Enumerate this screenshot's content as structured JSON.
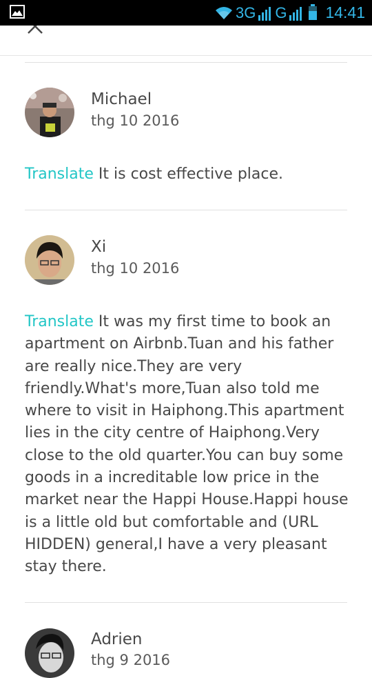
{
  "status_bar": {
    "network1": "3G",
    "network2": "G",
    "time": "14:41"
  },
  "reviews": [
    {
      "name": "Michael",
      "date": "thg 10 2016",
      "translate_label": "Translate",
      "text": "It is cost effective place."
    },
    {
      "name": "Xi",
      "date": "thg 10 2016",
      "translate_label": "Translate",
      "text": "It was my first time to book an apartment on Airbnb.Tuan and his father are really nice.They are very friendly.What's more,Tuan also told me where to visit in Haiphong.This apartment lies in the city centre of Haiphong.Very close to the old quarter.You can buy some goods in a increditable low price in the market near the Happi House.Happi house is a little old but comfortable and (URL HIDDEN) general,I have a very pleasant stay there."
    },
    {
      "name": "Adrien",
      "date": "thg 9 2016"
    }
  ]
}
